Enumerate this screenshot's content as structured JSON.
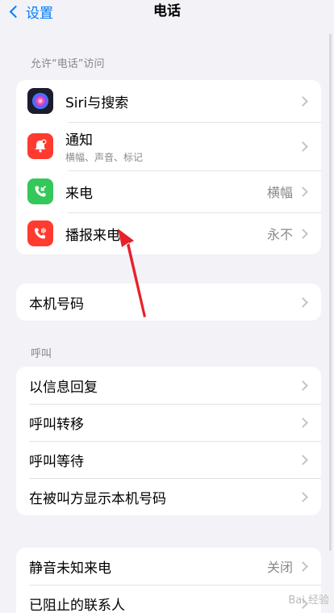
{
  "nav": {
    "back_label": "设置",
    "title": "电话"
  },
  "sections": {
    "access_header": "允许“电话”访问",
    "calls_header": "呼叫"
  },
  "access_items": [
    {
      "label": "Siri与搜索",
      "value": "",
      "icon": "siri-icon"
    },
    {
      "label": "通知",
      "sublabel": "横幅、声音、标记",
      "value": "",
      "icon": "notification-bell-icon"
    },
    {
      "label": "来电",
      "value": "横幅",
      "icon": "incoming-call-icon"
    },
    {
      "label": "播报来电",
      "value": "永不",
      "icon": "announce-call-icon"
    }
  ],
  "my_number": {
    "label": "本机号码"
  },
  "call_items": [
    {
      "label": "以信息回复"
    },
    {
      "label": "呼叫转移"
    },
    {
      "label": "呼叫等待"
    },
    {
      "label": "在被叫方显示本机号码"
    }
  ],
  "bottom_items": [
    {
      "label": "静音未知来电",
      "value": "关闭"
    },
    {
      "label": "已阻止的联系人",
      "value": ""
    }
  ],
  "watermark": "Bai 经验",
  "colors": {
    "accent": "#007aff",
    "notification": "#ff3b30",
    "phone_green": "#34c759",
    "announce_red": "#ff3b30",
    "arrow": "#e8202a"
  }
}
